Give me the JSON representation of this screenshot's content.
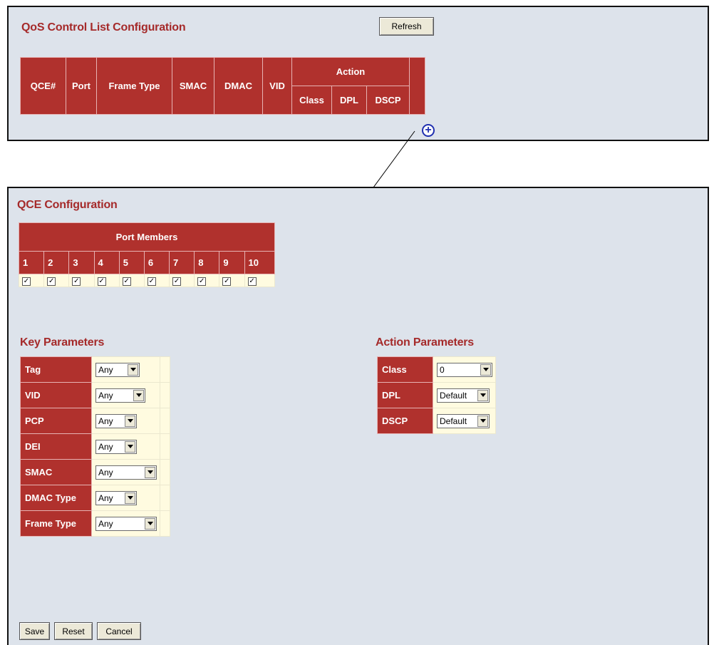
{
  "qos_list": {
    "title": "QoS Control List Configuration",
    "refresh_label": "Refresh",
    "headers": {
      "qce": "QCE#",
      "port": "Port",
      "frame_type": "Frame Type",
      "smac": "SMAC",
      "dmac": "DMAC",
      "vid": "VID",
      "action": "Action",
      "class": "Class",
      "dpl": "DPL",
      "dscp": "DSCP"
    },
    "add_icon": "plus-circle-icon"
  },
  "qce": {
    "title": "QCE Configuration",
    "port_members_label": "Port Members",
    "ports": [
      "1",
      "2",
      "3",
      "4",
      "5",
      "6",
      "7",
      "8",
      "9",
      "10"
    ],
    "port_checked": [
      true,
      true,
      true,
      true,
      true,
      true,
      true,
      true,
      true,
      true
    ],
    "key_parameters_title": "Key Parameters",
    "key_parameters": [
      {
        "label": "Tag",
        "value": "Any"
      },
      {
        "label": "VID",
        "value": "Any"
      },
      {
        "label": "PCP",
        "value": "Any"
      },
      {
        "label": "DEI",
        "value": "Any"
      },
      {
        "label": "SMAC",
        "value": "Any"
      },
      {
        "label": "DMAC Type",
        "value": "Any"
      },
      {
        "label": "Frame Type",
        "value": "Any"
      }
    ],
    "action_parameters_title": "Action Parameters",
    "action_parameters": [
      {
        "label": "Class",
        "value": "0"
      },
      {
        "label": "DPL",
        "value": "Default"
      },
      {
        "label": "DSCP",
        "value": "Default"
      }
    ],
    "buttons": {
      "save": "Save",
      "reset": "Reset",
      "cancel": "Cancel"
    }
  },
  "colors": {
    "header_red": "#b0312d",
    "title_red": "#a52a2a",
    "panel_bg": "#dde3eb",
    "cell_bg": "#fffbe0",
    "icon_blue": "#2030b0"
  }
}
